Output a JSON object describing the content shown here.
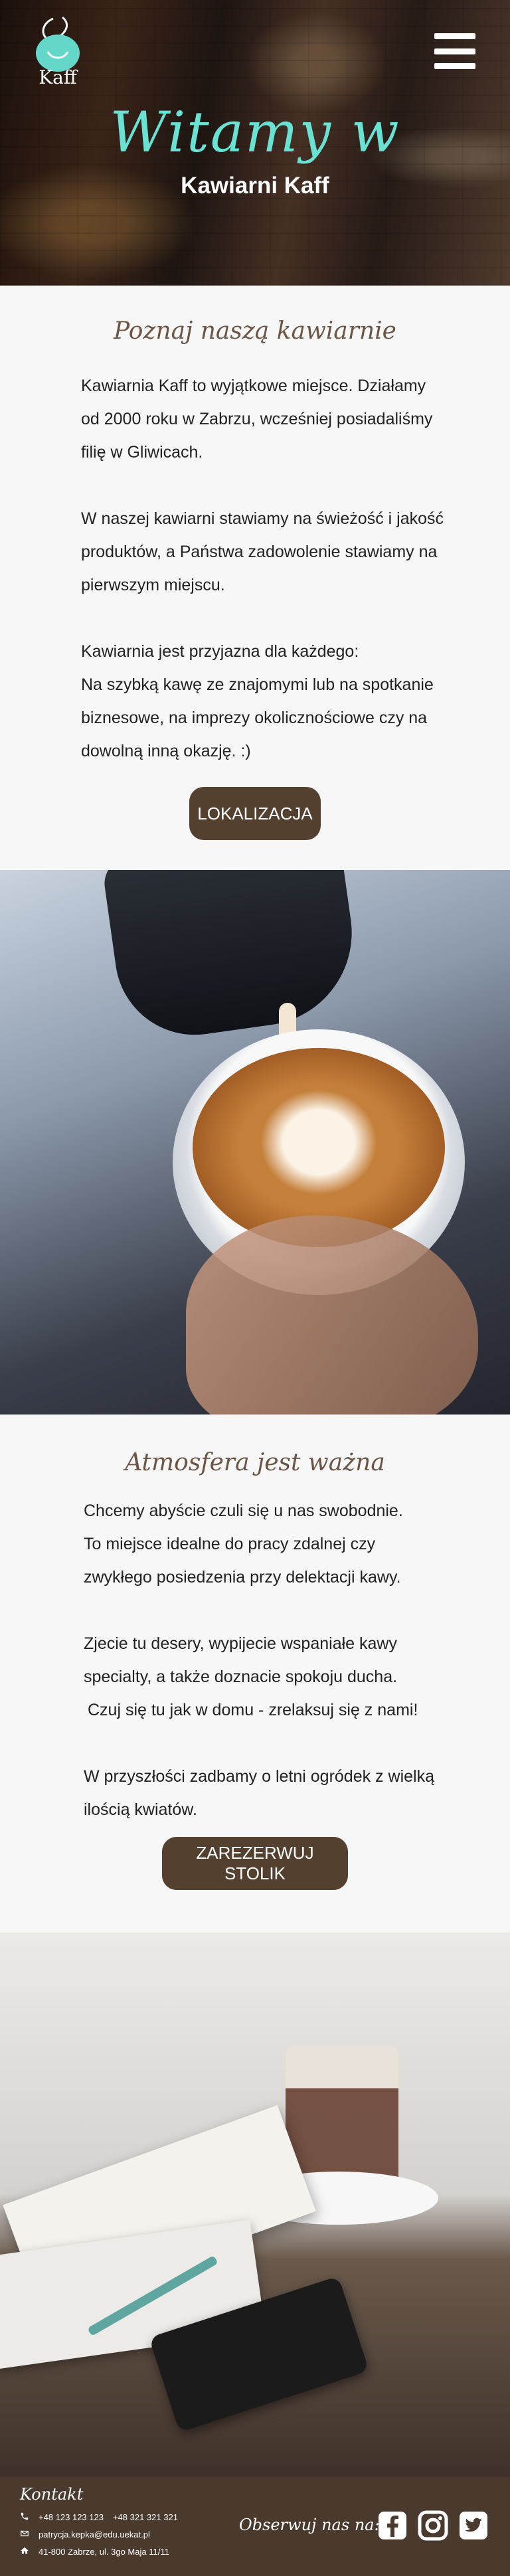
{
  "hero": {
    "logo_text": "Kaff",
    "title": "Witamy w",
    "subtitle": "Kawiarni Kaff"
  },
  "about": {
    "title": "Poznaj naszą kawiarnie",
    "p1": "Kawiarnia Kaff to wyjątkowe miejsce. Działamy",
    "p2": "od 2000 roku w Zabrzu, wcześniej posiadaliśmy",
    "p3": "filię w Gliwicach.",
    "p4": "W naszej kawiarni stawiamy na świeżość i jakość",
    "p5": "produktów, a Państwa zadowolenie stawiamy na",
    "p6": "pierwszym miejscu.",
    "p7": "Kawiarnia jest przyjazna dla każdego:",
    "p8": "Na szybką kawę ze znajomymi lub na spotkanie",
    "p9": "biznesowe, na imprezy okolicznościowe czy na",
    "p10": "dowolną inną okazję. :)",
    "button": "LOKALIZACJA"
  },
  "atmosphere": {
    "title": "Atmosfera jest ważna",
    "p1": "Chcemy abyście czuli się u nas swobodnie.",
    "p2": "To miejsce idealne do pracy zdalnej czy",
    "p3": "zwykłego posiedzenia przy delektacji kawy.",
    "p4": "Zjecie tu desery, wypijecie wspaniałe kawy",
    "p5": "specialty, a także doznacie spokoju ducha.",
    "p6": "Czuj się tu jak w domu - zrelaksuj się z nami!",
    "p7": "W przyszłości zadbamy o letni ogródek z wielką",
    "p8": "ilością kwiatów.",
    "button": "ZAREZERWUJ STOLIK"
  },
  "footer": {
    "contact_title": "Kontakt",
    "phone_1": "+48 123 123 123",
    "phone_2": "+48 321 321 321",
    "email": "patrycja.kepka@edu.uekat.pl",
    "address": "41-800 Zabrze, ul. 3go Maja 11/11",
    "follow_title": "Obserwuj nas na:"
  },
  "colors": {
    "hero_title": "#69e2d4",
    "accent_brown": "#54402f",
    "footer_bg": "#4a3a2d",
    "section_bg": "#f7f7f7"
  },
  "icons": [
    "menu-icon",
    "phone-icon",
    "mail-icon",
    "home-icon",
    "facebook-icon",
    "instagram-icon",
    "twitter-icon"
  ]
}
